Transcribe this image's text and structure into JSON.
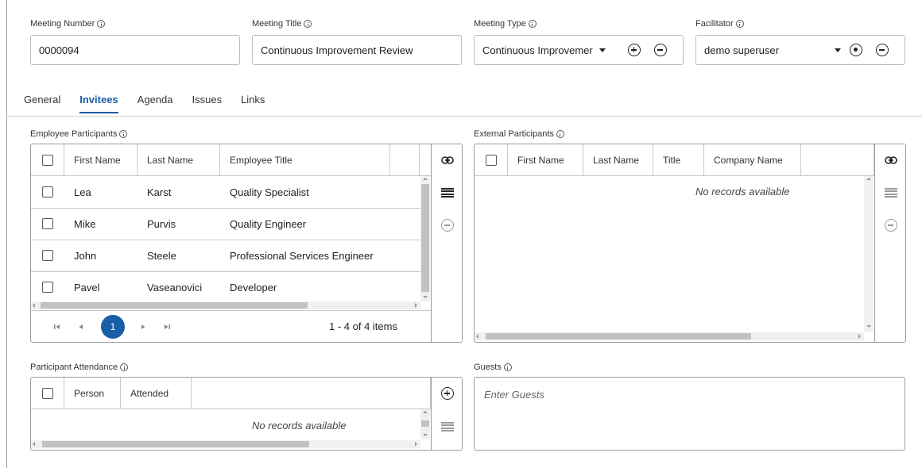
{
  "meeting": {
    "number_label": "Meeting Number",
    "number_value": "0000094",
    "title_label": "Meeting Title",
    "title_value": "Continuous Improvement Review",
    "type_label": "Meeting Type",
    "type_value": "Continuous Improvemer",
    "facilitator_label": "Facilitator",
    "facilitator_value": "demo superuser"
  },
  "tabs": [
    {
      "label": "General"
    },
    {
      "label": "Invitees"
    },
    {
      "label": "Agenda"
    },
    {
      "label": "Issues"
    },
    {
      "label": "Links"
    }
  ],
  "active_tab": "Invitees",
  "employee_participants": {
    "label": "Employee Participants",
    "columns": [
      "First Name",
      "Last Name",
      "Employee Title"
    ],
    "rows": [
      {
        "first": "Lea",
        "last": "Karst",
        "title": "Quality Specialist"
      },
      {
        "first": "Mike",
        "last": "Purvis",
        "title": "Quality Engineer"
      },
      {
        "first": "John",
        "last": "Steele",
        "title": "Professional Services Engineer"
      },
      {
        "first": "Pavel",
        "last": "Vaseanovici",
        "title": "Developer"
      }
    ],
    "current_page": "1",
    "pager_summary": "1 - 4 of 4 items"
  },
  "external_participants": {
    "label": "External Participants",
    "columns": [
      "First Name",
      "Last Name",
      "Title",
      "Company Name"
    ],
    "empty_message": "No records available"
  },
  "participant_attendance": {
    "label": "Participant Attendance",
    "columns": [
      "Person",
      "Attended"
    ],
    "empty_message": "No records available"
  },
  "guests": {
    "label": "Guests",
    "placeholder": "Enter Guests"
  },
  "colors": {
    "accent": "#1a5ea8",
    "border": "#9a9a9a",
    "icon_disabled": "#9a9a9a"
  },
  "icons": {
    "link": "link-icon",
    "select_all": "lines-icon",
    "remove": "minus-circle-icon",
    "add": "plus-circle-icon",
    "target": "target-circle-icon",
    "info": "info-icon"
  }
}
